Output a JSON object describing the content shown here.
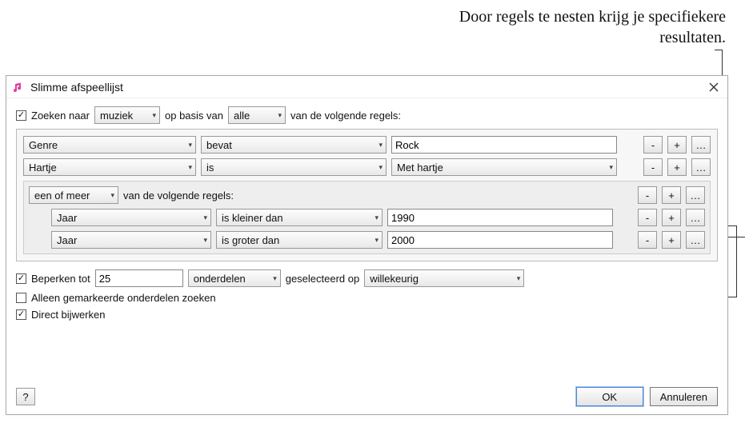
{
  "annotation": "Door regels te nesten krijg je specifiekere resultaten.",
  "dialog": {
    "title": "Slimme afspeellijst",
    "match": {
      "checkbox_label": "Zoeken naar",
      "media_type": "muziek",
      "middle": "op basis van",
      "any_all": "alle",
      "suffix": "van de volgende regels:"
    },
    "rules": [
      {
        "field": "Genre",
        "op": "bevat",
        "value": "Rock",
        "value_type": "text"
      },
      {
        "field": "Hartje",
        "op": "is",
        "value": "Met hartje",
        "value_type": "select"
      }
    ],
    "nested": {
      "mode": "een of meer",
      "suffix": "van de volgende regels:",
      "rules": [
        {
          "field": "Jaar",
          "op": "is kleiner dan",
          "value": "1990"
        },
        {
          "field": "Jaar",
          "op": "is groter dan",
          "value": "2000"
        }
      ]
    },
    "limit": {
      "label": "Beperken tot",
      "value": "25",
      "unit": "onderdelen",
      "selected_by_label": "geselecteerd op",
      "selected_by": "willekeurig"
    },
    "only_checked_label": "Alleen gemarkeerde onderdelen zoeken",
    "live_update_label": "Direct bijwerken",
    "buttons": {
      "help": "?",
      "ok": "OK",
      "cancel": "Annuleren",
      "remove": "-",
      "add": "+",
      "nest": "…"
    }
  }
}
